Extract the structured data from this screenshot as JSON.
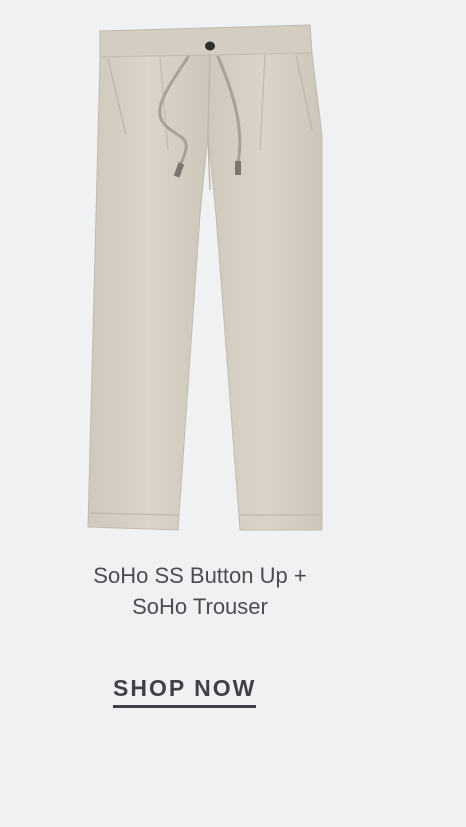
{
  "product": {
    "title_line1": "SoHo SS Button Up +",
    "title_line2": "SoHo Trouser",
    "cta_label": "SHOP NOW"
  },
  "colors": {
    "background": "#f0f1f3",
    "fabric": "#d7d1c5",
    "text": "#4b4d52",
    "cta": "#3f4146"
  }
}
